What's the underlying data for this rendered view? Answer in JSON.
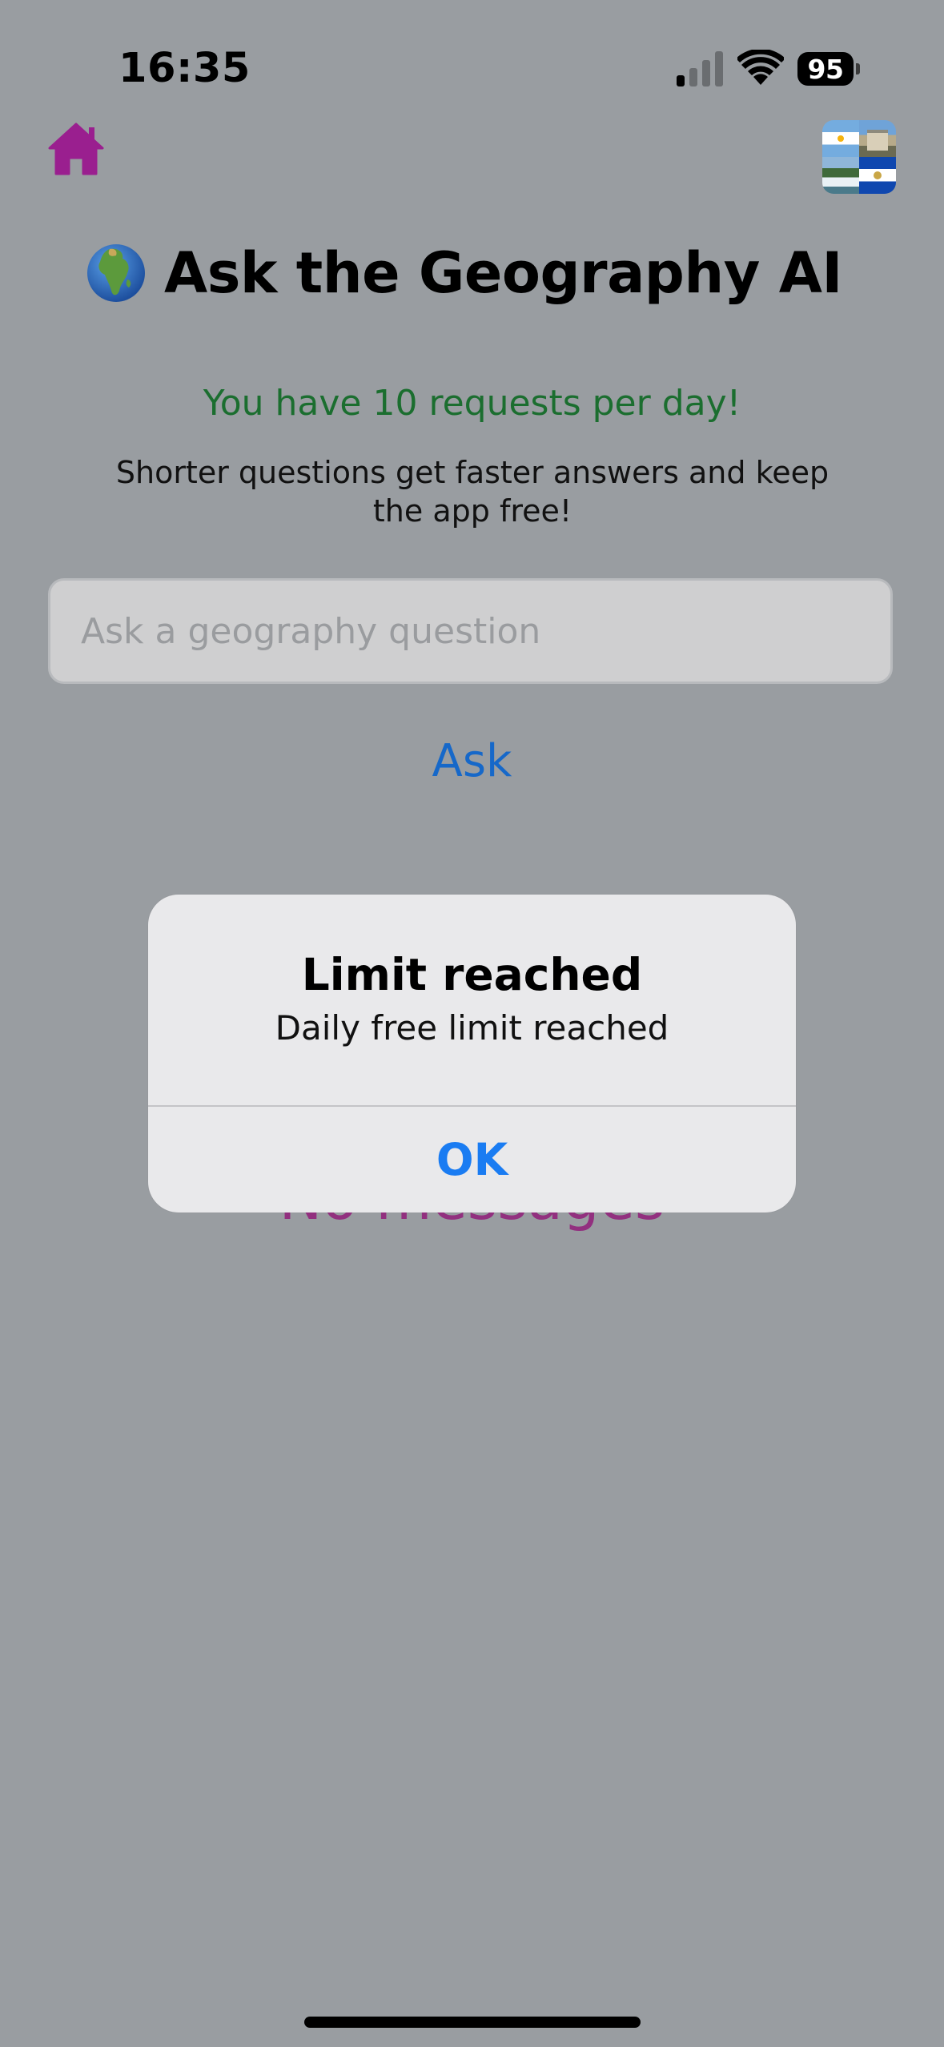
{
  "status_bar": {
    "time": "16:35",
    "battery_level": "95",
    "signal_bars_active": 1,
    "signal_bars_total": 4
  },
  "nav": {
    "home_icon": "house-icon",
    "home_color": "#9a1f8f",
    "thumbnail_icon": "flags-collage-thumbnail"
  },
  "header": {
    "globe_icon": "globe-africa-emoji",
    "title": "Ask the Geography AI"
  },
  "limits": {
    "requests_note": "You have 10 requests per day!",
    "tip": "Shorter questions get faster answers and keep the app free!"
  },
  "question_form": {
    "placeholder": "Ask a geography question",
    "value": "",
    "ask_label": "Ask"
  },
  "messages": {
    "empty_label": "No messages"
  },
  "alert": {
    "title": "Limit reached",
    "message": "Daily free limit reached",
    "ok_label": "OK"
  },
  "colors": {
    "overlay_background": "#999da1",
    "accent_green": "#1b6e2f",
    "link_blue": "#1668c9",
    "empty_state_purple": "#92307f",
    "alert_button_blue": "#1a7cf2"
  }
}
